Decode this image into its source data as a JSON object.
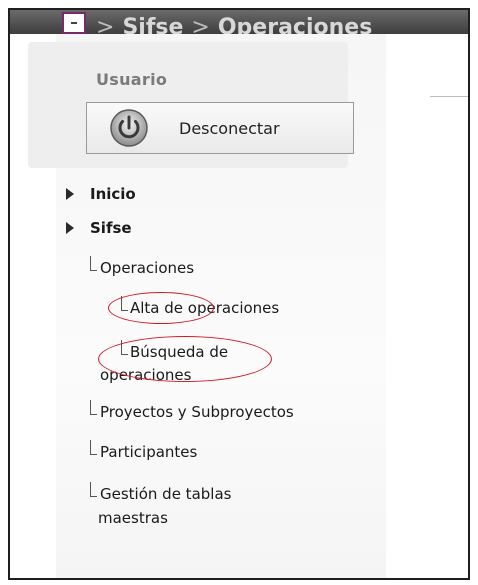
{
  "header": {
    "breadcrumb": [
      "Sifse",
      "Operaciones"
    ],
    "separator": ">"
  },
  "user_panel": {
    "title": "Usuario",
    "logout_label": "Desconectar"
  },
  "menu": {
    "sections": [
      {
        "label": "Inicio"
      },
      {
        "label": "Sifse"
      }
    ],
    "tree": [
      {
        "label": "Operaciones"
      },
      {
        "label": "Alta de operaciones"
      },
      {
        "label_line1": "Búsqueda de",
        "label_line2": "operaciones"
      },
      {
        "label": "Proyectos y Subproyectos"
      },
      {
        "label": "Participantes"
      },
      {
        "label_line1": "Gestión de tablas",
        "label_line2": "maestras"
      }
    ]
  },
  "colors": {
    "header_bg": "#4e4e4e",
    "annotation": "#d11a2a",
    "frame": "#1f1f1f"
  },
  "icons": {
    "logout": "power-icon",
    "expand": "arrow-right-icon"
  }
}
